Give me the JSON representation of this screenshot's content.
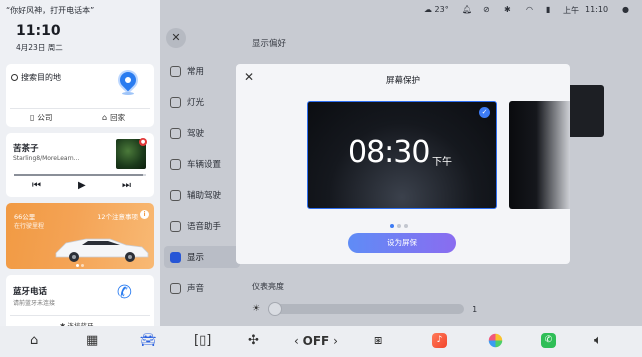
{
  "left_panel": {
    "voice_hint": "“你好风神，打开电话本”",
    "clock": "11:10",
    "date": "4月23日 周二",
    "nav": {
      "search_label": "搜索目的地",
      "company_label": "公司",
      "home_label": "回家"
    },
    "music": {
      "song": "苦茶子",
      "artist": "Starling8/MoreLearn...",
      "progress_fraction": 0.98
    },
    "vehicle": {
      "charge_label": "66公里",
      "sub_label": "在行驶里程",
      "notice_label": "12个注意事项"
    },
    "bluetooth": {
      "title": "蓝牙电话",
      "subtitle": "请前蓝牙未连接",
      "connect_label": "连接蓝牙"
    }
  },
  "status_bar": {
    "weather": "☁ 23°",
    "time_period": "上午",
    "time": "11:10"
  },
  "settings": {
    "pane_title": "显示偏好",
    "menu": [
      {
        "label": "常用"
      },
      {
        "label": "灯光"
      },
      {
        "label": "驾驶"
      },
      {
        "label": "车辆设置"
      },
      {
        "label": "辅助驾驶"
      },
      {
        "label": "语音助手"
      },
      {
        "label": "显示"
      },
      {
        "label": "声音"
      }
    ],
    "active_index": 6,
    "brightness_label": "仪表亮度",
    "brightness_value": "1"
  },
  "modal": {
    "title": "屏幕保护",
    "saver_time": "08:30",
    "saver_period": "下午",
    "set_button": "设为屏保",
    "pages": 3,
    "active_page": 0
  },
  "dock": {
    "ac_label": "OFF"
  },
  "colors": {
    "accent": "#3d7cf5",
    "orange_card": "#f19a43",
    "button_gradient_start": "#5f8cf6",
    "button_gradient_end": "#8a6cf0"
  }
}
